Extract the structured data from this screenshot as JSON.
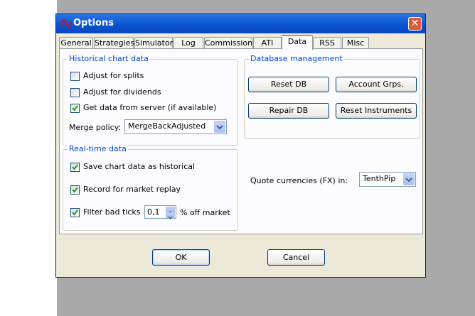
{
  "window": {
    "title": "Options",
    "close_glyph": "✕"
  },
  "tabs": [
    {
      "label": "General"
    },
    {
      "label": "Strategies"
    },
    {
      "label": "Simulator"
    },
    {
      "label": "Log"
    },
    {
      "label": "Commission"
    },
    {
      "label": "ATI"
    },
    {
      "label": "Data",
      "active": true
    },
    {
      "label": "RSS"
    },
    {
      "label": "Misc"
    }
  ],
  "historical": {
    "title": "Historical chart data",
    "adjust_splits": {
      "label": "Adjust for splits",
      "checked": false
    },
    "adjust_dividends": {
      "label": "Adjust for dividends",
      "checked": false
    },
    "get_from_server": {
      "label": "Get data from server (if available)",
      "checked": true
    },
    "merge_policy_label": "Merge policy:",
    "merge_policy_value": "MergeBackAdjusted"
  },
  "database": {
    "title": "Database management",
    "reset_db": "Reset DB",
    "account_grps": "Account Grps.",
    "repair_db": "Repair DB",
    "reset_instruments": "Reset Instruments"
  },
  "realtime": {
    "title": "Real-time data",
    "save_chart": {
      "label": "Save chart data as historical",
      "checked": true
    },
    "record_replay": {
      "label": "Record for market replay",
      "checked": true
    },
    "filter_ticks": {
      "label": "Filter bad ticks",
      "checked": true
    },
    "filter_value": "0,1",
    "filter_suffix": "% off market"
  },
  "quote": {
    "label": "Quote currencies (FX) in:",
    "value": "TenthPip"
  },
  "footer": {
    "ok": "OK",
    "cancel": "Cancel"
  },
  "colors": {
    "titlebar": "#0a54d1",
    "group_title": "#0046d5",
    "active_tab_accent": "#e68b2c",
    "check": "#21a121"
  }
}
